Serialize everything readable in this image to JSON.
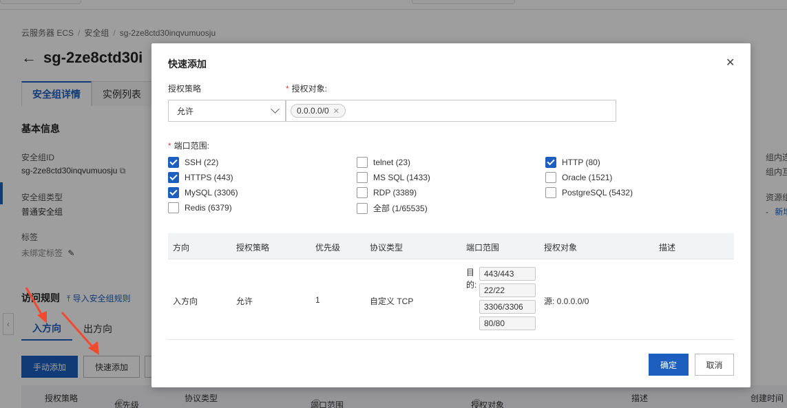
{
  "background": {
    "breadcrumb": [
      "云服务器 ECS",
      "安全组",
      "sg-2ze8ctd30inqvumuosju"
    ],
    "page_title": "sg-2ze8ctd30i",
    "tabs": [
      "安全组详情",
      "实例列表"
    ],
    "basic_info_title": "基本信息",
    "sg_id_label": "安全组ID",
    "sg_id_value": "sg-2ze8ctd30inqvumuosju",
    "sg_type_label": "安全组类型",
    "sg_type_value": "普通安全组",
    "tags_label": "标签",
    "tags_value": "未绑定标签",
    "right_col": [
      "组内连",
      "组内互",
      "资源组",
      "-",
      "新增"
    ],
    "rules_title": "访问规则",
    "import_rules": "导入安全组规则",
    "direction_tabs": [
      "入方向",
      "出方向"
    ],
    "manual_add": "手动添加",
    "quick_add": "快速添加",
    "table_headers": [
      "授权策略",
      "优先级",
      "协议类型",
      "端口范围",
      "授权对象",
      "描述",
      "创建时间"
    ]
  },
  "modal": {
    "title": "快速添加",
    "policy_label": "授权策略",
    "policy_value": "允许",
    "target_label": "授权对象:",
    "target_tag": "0.0.0.0/0",
    "port_range_label": "端口范围:",
    "ports": [
      {
        "label": "SSH (22)",
        "checked": true
      },
      {
        "label": "HTTPS (443)",
        "checked": true
      },
      {
        "label": "MySQL (3306)",
        "checked": true
      },
      {
        "label": "Redis (6379)",
        "checked": false
      },
      {
        "label": "telnet (23)",
        "checked": false
      },
      {
        "label": "MS SQL (1433)",
        "checked": false
      },
      {
        "label": "RDP (3389)",
        "checked": false
      },
      {
        "label": "全部 (1/65535)",
        "checked": false
      },
      {
        "label": "HTTP (80)",
        "checked": true
      },
      {
        "label": "Oracle (1521)",
        "checked": false
      },
      {
        "label": "PostgreSQL (5432)",
        "checked": false
      }
    ],
    "preview_headers": [
      "方向",
      "授权策略",
      "优先级",
      "协议类型",
      "端口范围",
      "授权对象",
      "描述"
    ],
    "preview_row": {
      "direction": "入方向",
      "policy": "允许",
      "priority": "1",
      "protocol": "自定义 TCP",
      "dest_label": "目的:",
      "ports": [
        "443/443",
        "22/22",
        "3306/3306",
        "80/80"
      ],
      "target": "源: 0.0.0.0/0",
      "description": ""
    },
    "confirm": "确定",
    "cancel": "取消"
  },
  "colors": {
    "accent": "#1c5fbf",
    "required": "#e4393c",
    "annotation_arrow": "#f2492f"
  }
}
